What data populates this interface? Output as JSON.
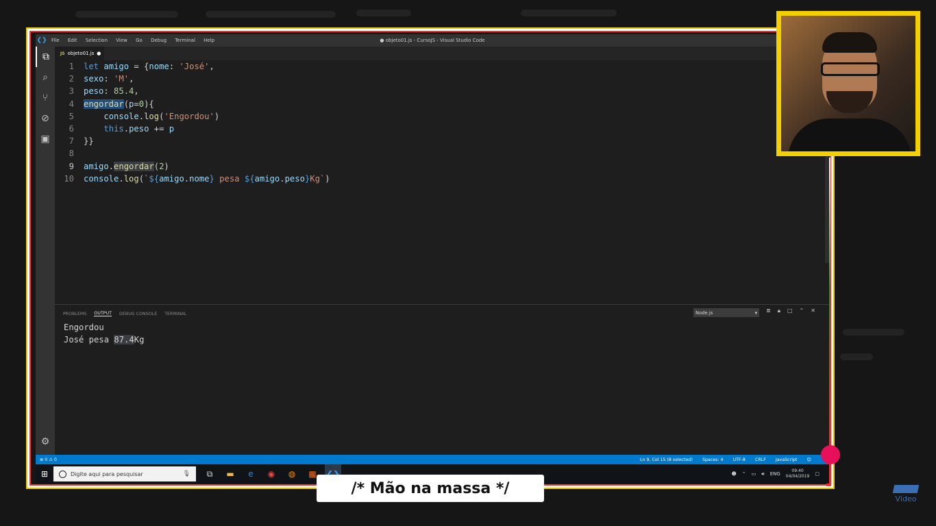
{
  "window": {
    "title": "● objeto01.js - CursoJS - Visual Studio Code"
  },
  "menu": [
    "File",
    "Edit",
    "Selection",
    "View",
    "Go",
    "Debug",
    "Terminal",
    "Help"
  ],
  "activity_icons": [
    "files-icon",
    "search-icon",
    "source-control-icon",
    "debug-icon",
    "extensions-icon"
  ],
  "tab": {
    "label": "objeto01.js",
    "lang_badge": "JS",
    "dirty_marker": "●"
  },
  "editor": {
    "line_numbers": [
      "1",
      "2",
      "3",
      "4",
      "5",
      "6",
      "7",
      "8",
      "9",
      "10"
    ]
  },
  "code": {
    "l1": {
      "kw": "let",
      "var": "amigo",
      "rest1": " = {",
      "key": "nome",
      "colon": ": ",
      "str": "'José'",
      "end": ","
    },
    "l2": {
      "key": "sexo",
      "colon": ": ",
      "str": "'M'",
      "end": ","
    },
    "l3": {
      "key": "peso",
      "colon": ": ",
      "num": "85.4",
      "end": ","
    },
    "l4": {
      "fn": "engordar",
      "params": "(",
      "p": "p",
      "eq": "=",
      "num": "0",
      "end": "){"
    },
    "l5": {
      "obj": "console",
      "dot": ".",
      "fn": "log",
      "open": "(",
      "str": "'Engordou'",
      "close": ")"
    },
    "l6": {
      "kw": "this",
      "dot": ".",
      "prop": "peso",
      "op": " += ",
      "var": "p"
    },
    "l7": {
      "text": "}}"
    },
    "l9": {
      "obj": "amigo",
      "dot": ".",
      "fn": "engordar",
      "open": "(",
      "num": "2",
      "close": ")"
    },
    "l10": {
      "obj": "console",
      "dot": ".",
      "fn": "log",
      "open": "(",
      "tpl1": "`",
      "e1": "${",
      "v1": "amigo.nome",
      "c1": "}",
      "s1": " pesa ",
      "e2": "${",
      "v2": "amigo.peso",
      "c2": "}",
      "s2": "Kg`",
      "close": ")"
    }
  },
  "panel": {
    "tabs": [
      "PROBLEMS",
      "OUTPUT",
      "DEBUG CONSOLE",
      "TERMINAL"
    ],
    "active_tab": "OUTPUT",
    "select_value": "Node.js",
    "output_lines": [
      "Engordou",
      "José pesa ",
      "87.4",
      "Kg"
    ]
  },
  "status": {
    "left": "⊗ 0 ⚠ 0",
    "items": [
      "Ln 9, Col 15 (8 selected)",
      "Spaces: 4",
      "UTF-8",
      "CRLF",
      "JavaScript"
    ]
  },
  "taskbar": {
    "search_placeholder": "Digite aqui para pesquisar",
    "lang": "ENG",
    "time": "09:40",
    "date": "04/04/2019"
  },
  "caption": "/* Mão na massa */",
  "logo_text": "Vídeo"
}
